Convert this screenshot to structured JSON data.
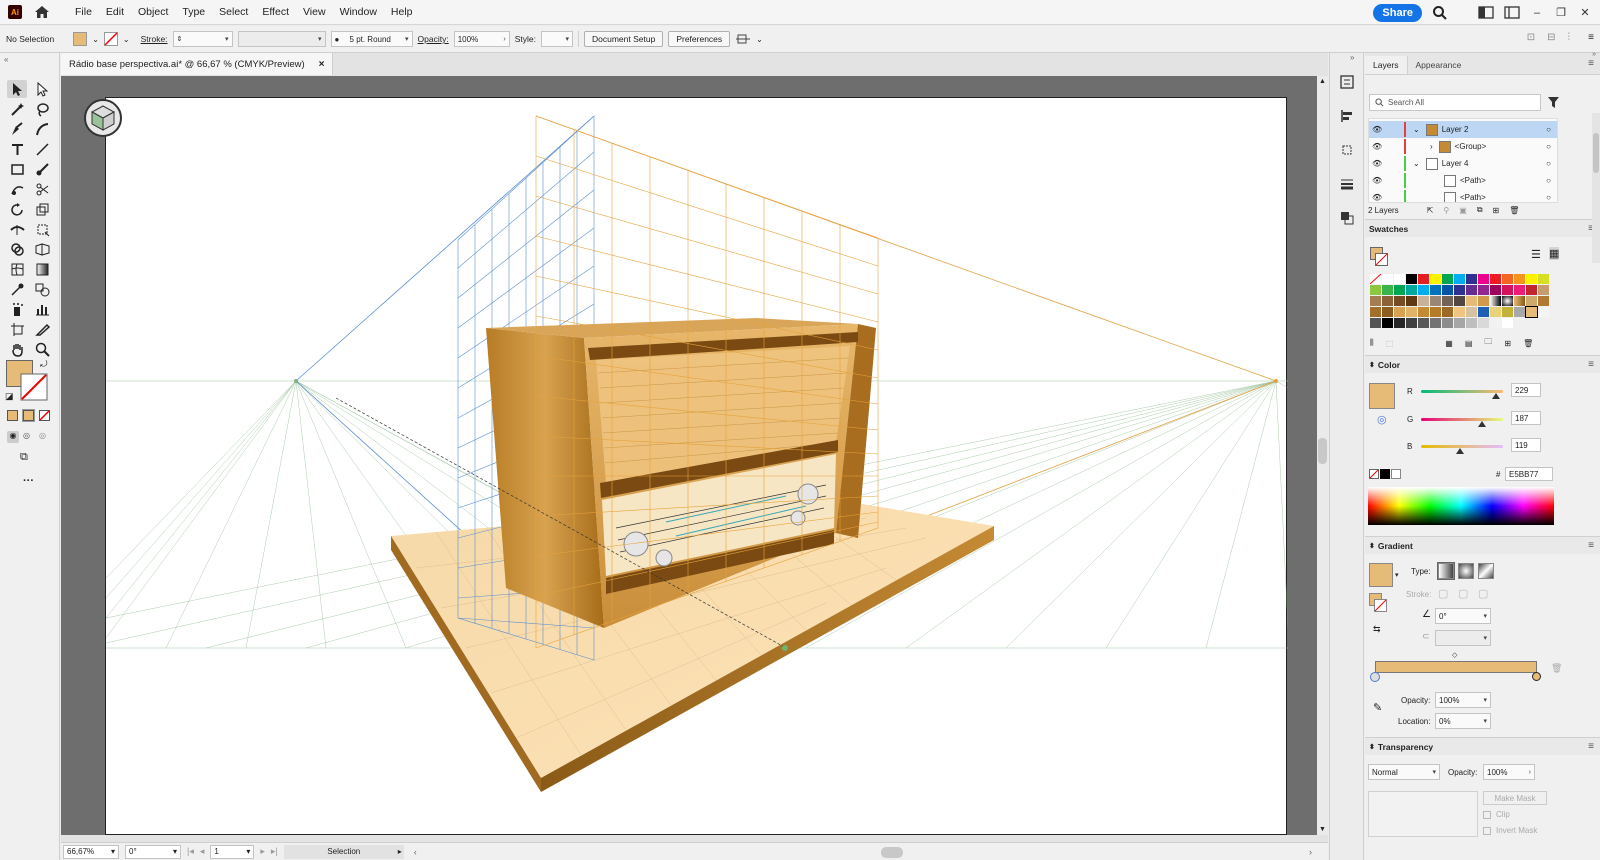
{
  "app": {
    "logo": "Ai"
  },
  "menu": [
    "File",
    "Edit",
    "Object",
    "Type",
    "Select",
    "Effect",
    "View",
    "Window",
    "Help"
  ],
  "topright": {
    "share": "Share"
  },
  "control": {
    "selection": "No Selection",
    "stroke_label": "Stroke:",
    "brush": "5 pt. Round",
    "opacity_label": "Opacity:",
    "opacity": "100%",
    "style_label": "Style:",
    "doc_setup": "Document Setup",
    "preferences": "Preferences"
  },
  "doc": {
    "tab_title": "Rádio base perspectiva.ai* @ 66,67 % (CMYK/Preview)",
    "close": "×"
  },
  "status": {
    "zoom": "66,67%",
    "rotate": "0°",
    "artboard": "1",
    "tool": "Selection"
  },
  "layers_panel": {
    "tabs": [
      "Layers",
      "Appearance"
    ],
    "search_placeholder": "Search All",
    "rows": [
      {
        "name": "Layer 2",
        "color": "#e34040"
      },
      {
        "name": "<Group>",
        "color": "#e34040"
      },
      {
        "name": "Layer 4",
        "color": "#4bcc4b"
      },
      {
        "name": "<Path>",
        "color": "#4bcc4b"
      },
      {
        "name": "<Path>",
        "color": "#4bcc4b"
      }
    ],
    "count": "2 Layers"
  },
  "swatches": {
    "title": "Swatches"
  },
  "color": {
    "title": "Color",
    "r_label": "R",
    "g_label": "G",
    "b_label": "B",
    "r": "229",
    "g": "187",
    "b": "119",
    "hex_label": "#",
    "hex": "E5BB77",
    "fill": "#e5bb77"
  },
  "gradient": {
    "title": "Gradient",
    "type_label": "Type:",
    "stroke_label": "Stroke:",
    "angle": "0°",
    "opacity_label": "Opacity:",
    "opacity": "100%",
    "location_label": "Location:",
    "location": "0%"
  },
  "transparency": {
    "title": "Transparency",
    "mode": "Normal",
    "opacity_label": "Opacity:",
    "opacity": "100%",
    "make_mask": "Make Mask",
    "clip": "Clip",
    "invert": "Invert Mask"
  }
}
